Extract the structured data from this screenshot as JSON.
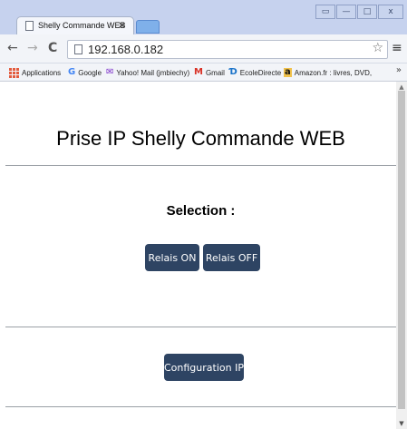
{
  "browser": {
    "tab": {
      "title": "Shelly Commande WEB",
      "close": "×"
    },
    "window_buttons": {
      "restore": "▭",
      "minimize": "—",
      "maximize": "□",
      "close": "x"
    },
    "nav": {
      "back": "←",
      "forward": "→",
      "reload": "C"
    },
    "address": {
      "url": "192.168.0.182",
      "star": "☆"
    },
    "menu": "≡",
    "bookmarks": [
      {
        "label": "Applications",
        "icon": "apps-grid-icon"
      },
      {
        "label": "Google",
        "icon": "G",
        "color": "#4285f4"
      },
      {
        "label": "Yahoo! Mail (jmbiechy)",
        "icon": "✉",
        "color": "#7b2ec9"
      },
      {
        "label": "Gmail",
        "icon": "M",
        "color": "#d93025"
      },
      {
        "label": "EcoleDirecte",
        "icon": "Ɗ",
        "color": "#1a73c9"
      },
      {
        "label": "Amazon.fr : livres, DVD,",
        "icon": "a",
        "color": "#111111"
      }
    ],
    "bookmarks_more": "»"
  },
  "page": {
    "title": "Prise IP Shelly Commande WEB",
    "selection_label": "Selection :",
    "relay_on_label": "Relais ON",
    "relay_off_label": "Relais OFF",
    "config_label": "Configuration IP"
  },
  "colors": {
    "button_bg": "#2e4463",
    "button_text": "#ffffff",
    "divider": "#9aa0a6",
    "titlebar": "#c6d2ee"
  },
  "scrollbar": {
    "up": "▲",
    "down": "▼"
  }
}
